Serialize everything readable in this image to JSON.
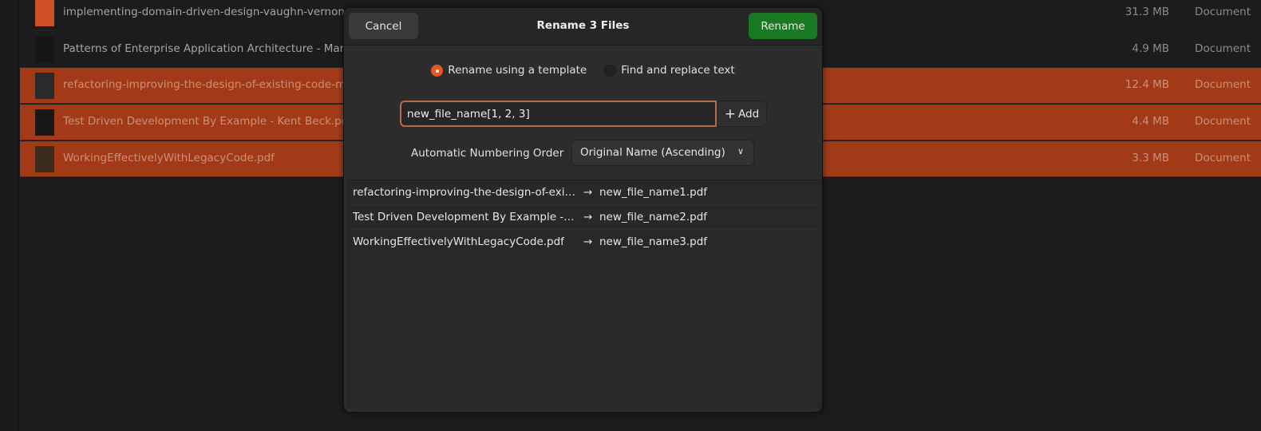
{
  "files": [
    {
      "name": "implementing-domain-driven-design-vaughn-vernon.pdf",
      "size": "31.3 MB",
      "type": "Document",
      "selected": false,
      "thumb": "#d0502a"
    },
    {
      "name": "Patterns of Enterprise Application Architecture - Martin Fowler.pdf",
      "size": "4.9 MB",
      "type": "Document",
      "selected": false,
      "thumb": "#151515"
    },
    {
      "name": "refactoring-improving-the-design-of-existing-code-martin-fowler.pdf",
      "size": "12.4 MB",
      "type": "Document",
      "selected": true,
      "thumb": "#2a2a2a"
    },
    {
      "name": "Test Driven Development By Example - Kent Beck.pdf",
      "size": "4.4 MB",
      "type": "Document",
      "selected": true,
      "thumb": "#181818"
    },
    {
      "name": "WorkingEffectivelyWithLegacyCode.pdf",
      "size": "3.3 MB",
      "type": "Document",
      "selected": true,
      "thumb": "#3a2a1a"
    }
  ],
  "dialog": {
    "title": "Rename 3 Files",
    "cancel": "Cancel",
    "rename": "Rename",
    "mode_template": "Rename using a template",
    "mode_replace": "Find and replace text",
    "template_value": "new_file_name[1, 2, 3]",
    "add_label": "Add",
    "numbering_label": "Automatic Numbering Order",
    "numbering_value": "Original Name (Ascending)",
    "preview": [
      {
        "original": "refactoring-improving-the-design-of-exi…",
        "arrow": "→",
        "new": "new_file_name1.pdf"
      },
      {
        "original": "Test Driven Development By Example - …",
        "arrow": "→",
        "new": "new_file_name2.pdf"
      },
      {
        "original": "WorkingEffectivelyWithLegacyCode.pdf",
        "arrow": "→",
        "new": "new_file_name3.pdf"
      }
    ]
  },
  "colors": {
    "accent": "#e95420",
    "selection": "#a23a18",
    "rename": "#1a7a23"
  }
}
